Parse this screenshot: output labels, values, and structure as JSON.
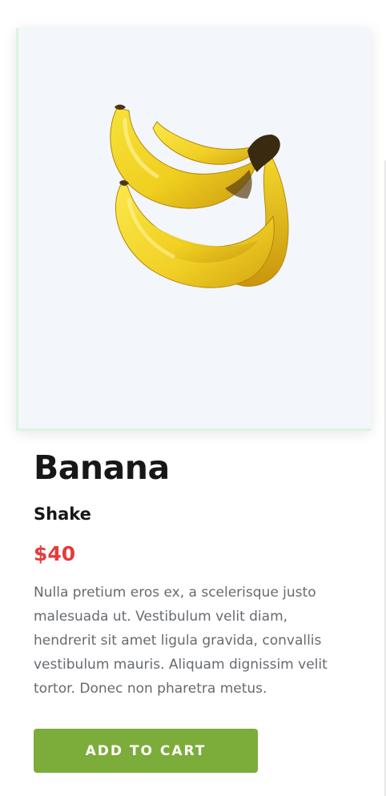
{
  "product": {
    "name": "Banana",
    "subtitle": "Shake",
    "price": "$40",
    "description": "Nulla pretium eros ex, a scelerisque justo malesuada ut. Vestibulum velit diam, hendrerit sit amet ligula gravida, convallis vestibulum mauris. Aliquam dignissim velit tortor. Donec non pharetra metus.",
    "image_icon": "banana-bunch-image"
  },
  "actions": {
    "add_to_cart_label": "ADD TO CART"
  },
  "colors": {
    "price": "#e53b3b",
    "button": "#7cac3a",
    "image_background": "#f3f6fb",
    "image_accent_border": "#d9f6df",
    "title_text": "#171717",
    "body_text": "#666a70"
  }
}
